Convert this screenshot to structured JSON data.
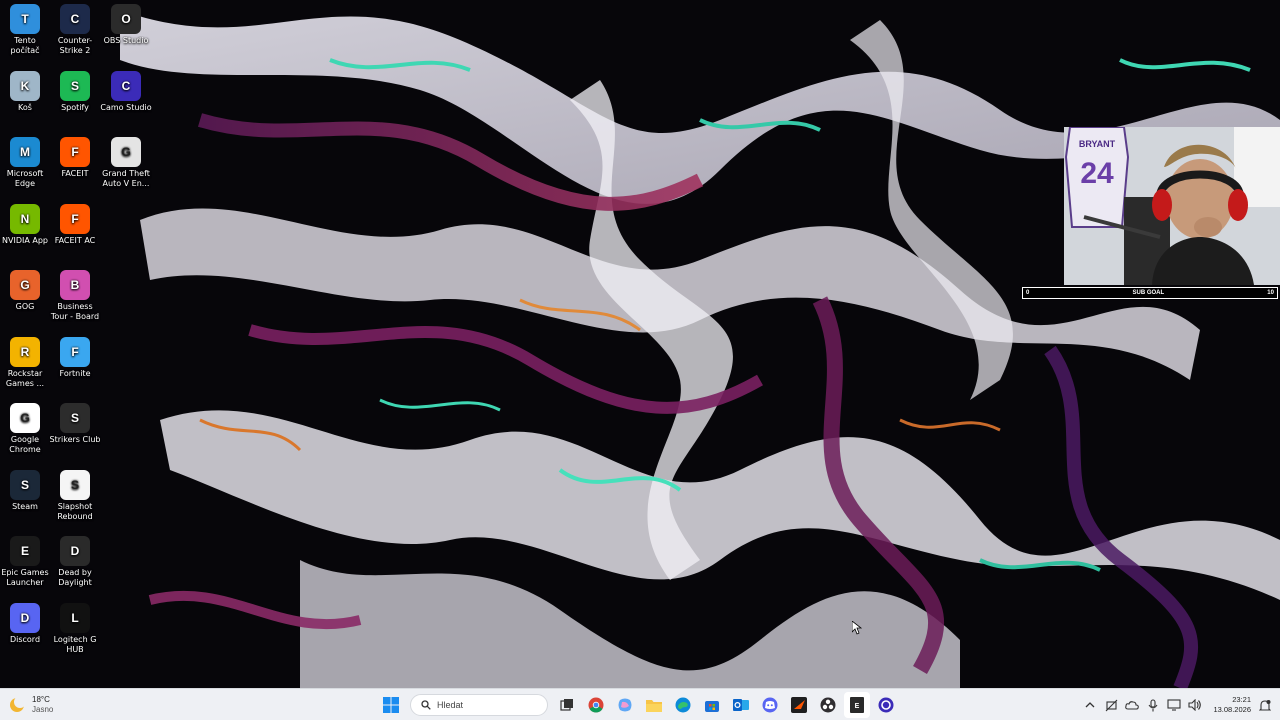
{
  "desktop": {
    "icons": [
      {
        "label": "Tento počítač",
        "icon": "monitor-icon",
        "color": "#2f8fdc"
      },
      {
        "label": "Counter-Strike 2",
        "icon": "cs2-icon",
        "color": "#1d2a4a"
      },
      {
        "label": "OBS Studio",
        "icon": "obs-icon",
        "color": "#2b2b2b"
      },
      {
        "label": "Koš",
        "icon": "recycle-bin-icon",
        "color": "#9fb6c8"
      },
      {
        "label": "Spotify",
        "icon": "spotify-icon",
        "color": "#1db954"
      },
      {
        "label": "Camo Studio",
        "icon": "camo-icon",
        "color": "#3b2bb8"
      },
      {
        "label": "Microsoft Edge",
        "icon": "edge-icon",
        "color": "#1b8ad1"
      },
      {
        "label": "FACEIT",
        "icon": "faceit-icon",
        "color": "#ff5500"
      },
      {
        "label": "Grand Theft Auto V En...",
        "icon": "gta-icon",
        "color": "#e4e4e4"
      },
      {
        "label": "NVIDIA App",
        "icon": "nvidia-icon",
        "color": "#76b900"
      },
      {
        "label": "FACEIT AC",
        "icon": "faceit-ac-icon",
        "color": "#ff5500"
      },
      {
        "label": "GOG",
        "icon": "gog-icon",
        "color": "#e8632b"
      },
      {
        "label": "Business Tour - Board Ga...",
        "icon": "business-tour-icon",
        "color": "#d14fb0"
      },
      {
        "label": "Rockstar Games ...",
        "icon": "rockstar-icon",
        "color": "#f3b300"
      },
      {
        "label": "Fortnite",
        "icon": "fortnite-icon",
        "color": "#3aa7f0"
      },
      {
        "label": "Google Chrome",
        "icon": "chrome-icon",
        "color": "#ffffff"
      },
      {
        "label": "Strikers Club",
        "icon": "strikers-club-icon",
        "color": "#2c2c2c"
      },
      {
        "label": "Steam",
        "icon": "steam-icon",
        "color": "#1b2838"
      },
      {
        "label": "Slapshot Rebound",
        "icon": "slapshot-icon",
        "color": "#f5f5f5"
      },
      {
        "label": "Epic Games Launcher",
        "icon": "epic-games-icon",
        "color": "#1a1a1a"
      },
      {
        "label": "Dead by Daylight",
        "icon": "dead-by-daylight-icon",
        "color": "#2a2a2a"
      },
      {
        "label": "Discord",
        "icon": "discord-icon",
        "color": "#5865f2"
      },
      {
        "label": "Logitech G HUB",
        "icon": "logitech-icon",
        "color": "#111111"
      }
    ]
  },
  "overlay": {
    "sub_goal_left": "0",
    "sub_goal_label": "SUB GOAL",
    "sub_goal_right": "10",
    "jersey_name": "BRYANT",
    "jersey_number": "24"
  },
  "taskbar": {
    "weather_temp": "18°C",
    "weather_desc": "Jasno",
    "search_placeholder": "Hledat",
    "time": "23:21",
    "date": "13.08.2026",
    "apps": [
      "task-view-icon",
      "chrome-icon",
      "copilot-icon",
      "file-explorer-icon",
      "edge-icon",
      "store-icon",
      "outlook-icon",
      "discord-icon",
      "faceit-icon",
      "obs-icon",
      "epic-icon",
      "camo-icon"
    ]
  }
}
